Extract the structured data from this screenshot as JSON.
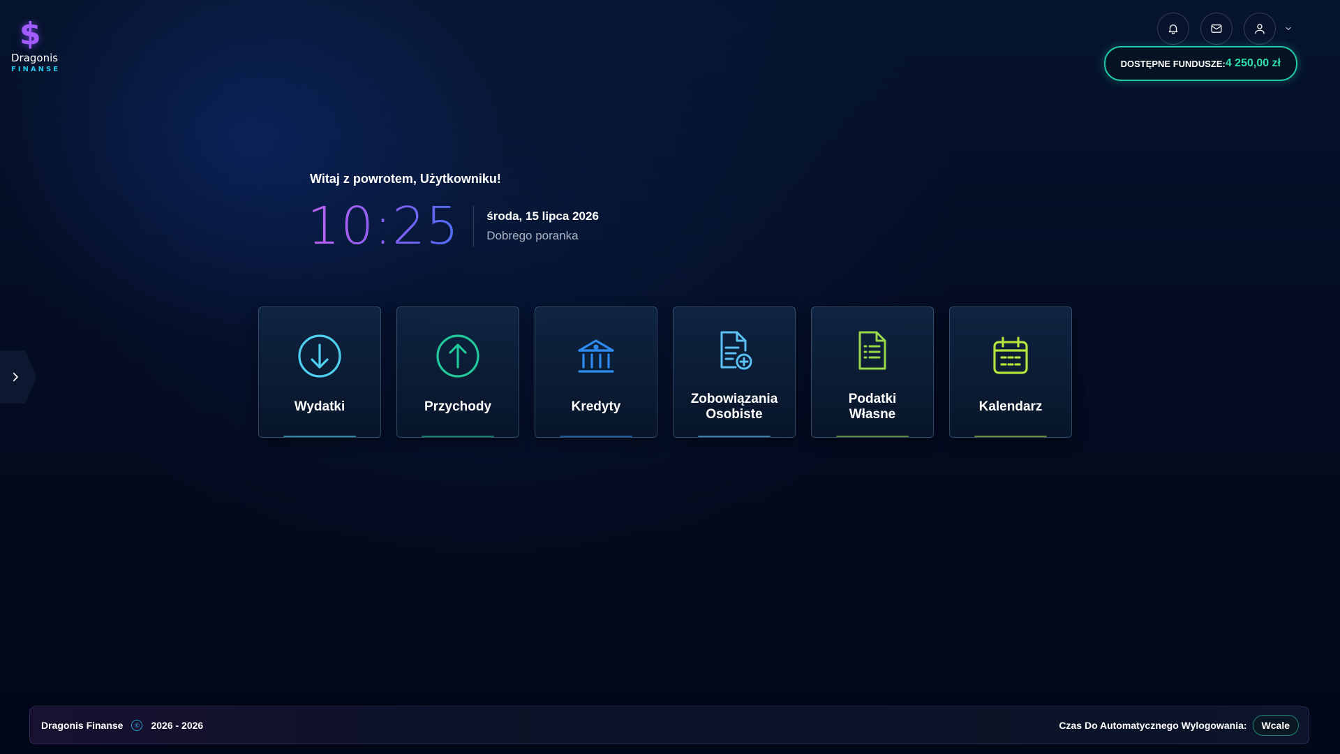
{
  "brand": {
    "icon": "$",
    "name": "Dragonis",
    "subtitle": "FINANSE",
    "color": "#a25cff"
  },
  "header": {
    "icons": [
      "bell-icon",
      "mail-icon",
      "user-icon",
      "chevron-down-icon"
    ],
    "funds_label": "DOSTĘPNE FUNDUSZE:",
    "funds_value": "4 250,00 zł",
    "funds_color": "#2fe0ac"
  },
  "greeting": {
    "welcome": "Witaj z powrotem, Użytkowniku!",
    "time": "10:25",
    "date": "środa, 15 lipca 2026",
    "daypart": "Dobrego poranka"
  },
  "tiles": [
    {
      "label": "Wydatki",
      "icon": "arrow-down-circle-icon",
      "color": "#4fd0f0"
    },
    {
      "label": "Przychody",
      "icon": "arrow-up-circle-icon",
      "color": "#22c79a"
    },
    {
      "label": "Kredyty",
      "icon": "bank-icon",
      "color": "#2e8cf0"
    },
    {
      "label": "Zobowiązania\nOsobiste",
      "icon": "document-plus-icon",
      "color": "#5cc2f5"
    },
    {
      "label": "Podatki\nWłasne",
      "icon": "document-list-icon",
      "color": "#9bd848"
    },
    {
      "label": "Kalendarz",
      "icon": "calendar-icon",
      "color": "#b6e03a"
    }
  ],
  "footer": {
    "brand": "Dragonis Finanse",
    "copyright_icon": "copyright-icon",
    "years": "2026 - 2026",
    "logout_label": "Czas Do Automatycznego Wylogowania:",
    "logout_value": "Wcale"
  }
}
